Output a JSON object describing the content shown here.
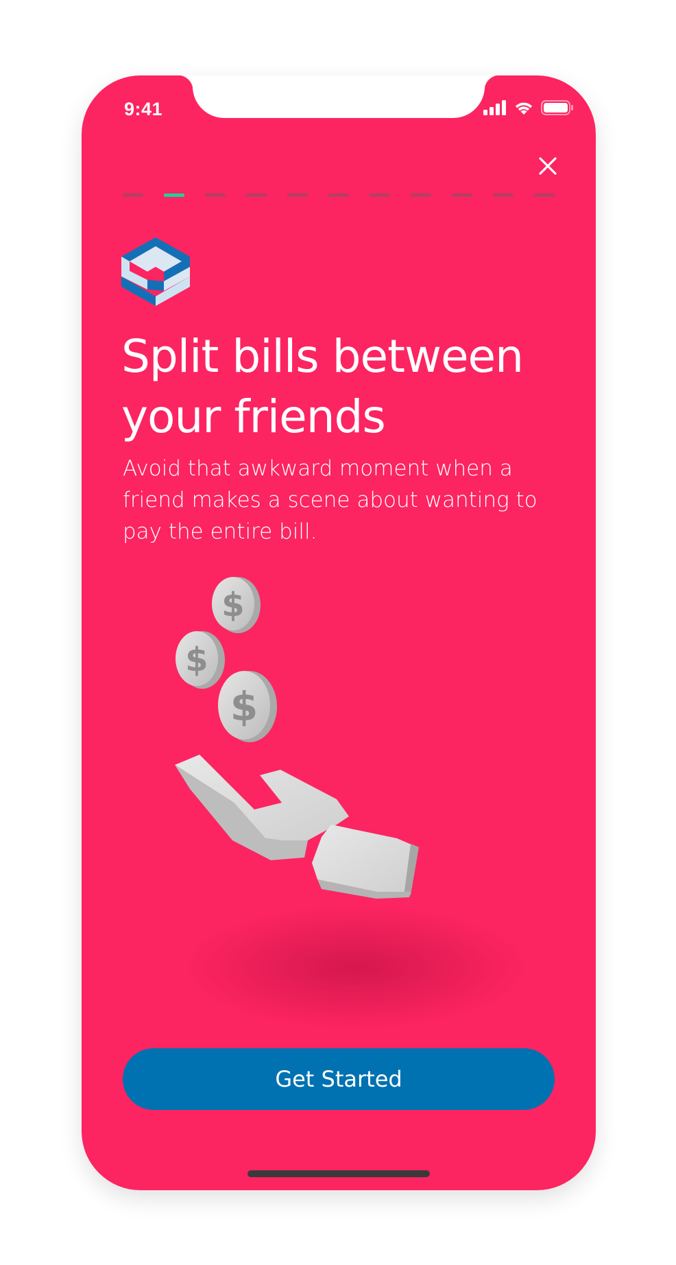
{
  "status_bar": {
    "time": "9:41",
    "icons": [
      "signal-icon",
      "wifi-icon",
      "battery-icon"
    ]
  },
  "onboarding": {
    "progress": {
      "total_steps": 11,
      "current_step": 2
    },
    "close_icon": "close-icon",
    "logo_icon": "app-logo-icon",
    "headline": "Split bills between your friends",
    "description": "Avoid that awkward moment when a friend makes a scene about wanting to pay the entire bill.",
    "illustration": "hand-with-coins-illustration",
    "cta_label": "Get Started"
  },
  "colors": {
    "background": "#fc2461",
    "button": "#0072b1",
    "progress_active": "#25cf9c",
    "progress_inactive": "#a84463",
    "text": "#ffffff"
  }
}
